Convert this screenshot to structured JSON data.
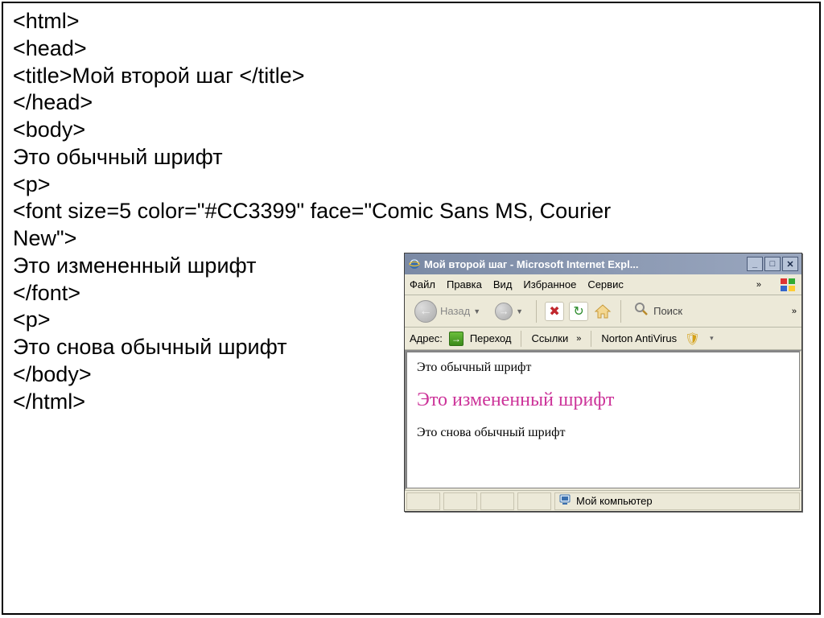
{
  "code": {
    "lines": [
      "<html>",
      "<head>",
      "<title>Мой второй шаг </title>",
      "</head>",
      "<body>",
      "Это обычный шрифт",
      "<p>",
      "<font size=5 color=\"#CC3399\" face=\"Comic Sans MS, Courier",
      "New\">",
      "Это измененный шрифт",
      "</font>",
      "<p>",
      "Это снова обычный шрифт",
      "</body>",
      "</html>"
    ]
  },
  "ie": {
    "title": "Мой второй шаг - Microsoft Internet Expl...",
    "menus": {
      "file": "Файл",
      "edit": "Правка",
      "view": "Вид",
      "favorites": "Избранное",
      "service": "Сервис"
    },
    "nav": {
      "back": "Назад",
      "search": "Поиск"
    },
    "addr": {
      "label": "Адрес:",
      "go": "Переход",
      "links": "Ссылки",
      "av": "Norton AntiVirus"
    },
    "content": {
      "line1": "Это обычный шрифт",
      "line2": "Это измененный шрифт",
      "line3": "Это снова обычный шрифт",
      "font_color": "#CC3399"
    },
    "status": {
      "zone": "Мой компьютер"
    }
  }
}
